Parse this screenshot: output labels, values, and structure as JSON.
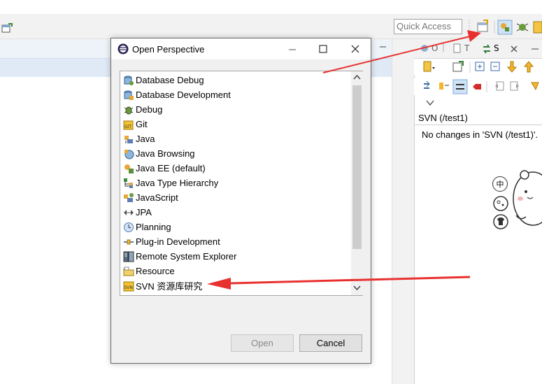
{
  "toolbar": {
    "quick_access_placeholder": "Quick Access"
  },
  "right_view": {
    "tabs": [
      "O",
      "T",
      "S"
    ],
    "title": "SVN (/test1)",
    "message": "No changes in 'SVN (/test1)'."
  },
  "floating_widget": {
    "items": [
      "中"
    ]
  },
  "dialog": {
    "title": "Open Perspective",
    "items": [
      {
        "label": "Database Debug",
        "icon": "database-debug-icon"
      },
      {
        "label": "Database Development",
        "icon": "database-dev-icon"
      },
      {
        "label": "Debug",
        "icon": "bug-icon"
      },
      {
        "label": "Git",
        "icon": "git-icon"
      },
      {
        "label": "Java",
        "icon": "java-icon"
      },
      {
        "label": "Java Browsing",
        "icon": "java-browsing-icon"
      },
      {
        "label": "Java EE (default)",
        "icon": "java-ee-icon"
      },
      {
        "label": "Java Type Hierarchy",
        "icon": "hierarchy-icon"
      },
      {
        "label": "JavaScript",
        "icon": "javascript-icon"
      },
      {
        "label": "JPA",
        "icon": "jpa-icon"
      },
      {
        "label": "Planning",
        "icon": "clock-icon"
      },
      {
        "label": "Plug-in Development",
        "icon": "plugin-icon"
      },
      {
        "label": "Remote System Explorer",
        "icon": "remote-system-icon"
      },
      {
        "label": "Resource",
        "icon": "folder-icon"
      },
      {
        "label": "SVN 资源库研究",
        "icon": "svn-icon"
      }
    ],
    "open_label": "Open",
    "cancel_label": "Cancel"
  },
  "colors": {
    "annotation_arrow": "#e8312f",
    "dialog_bg": "#f0f0f0"
  }
}
